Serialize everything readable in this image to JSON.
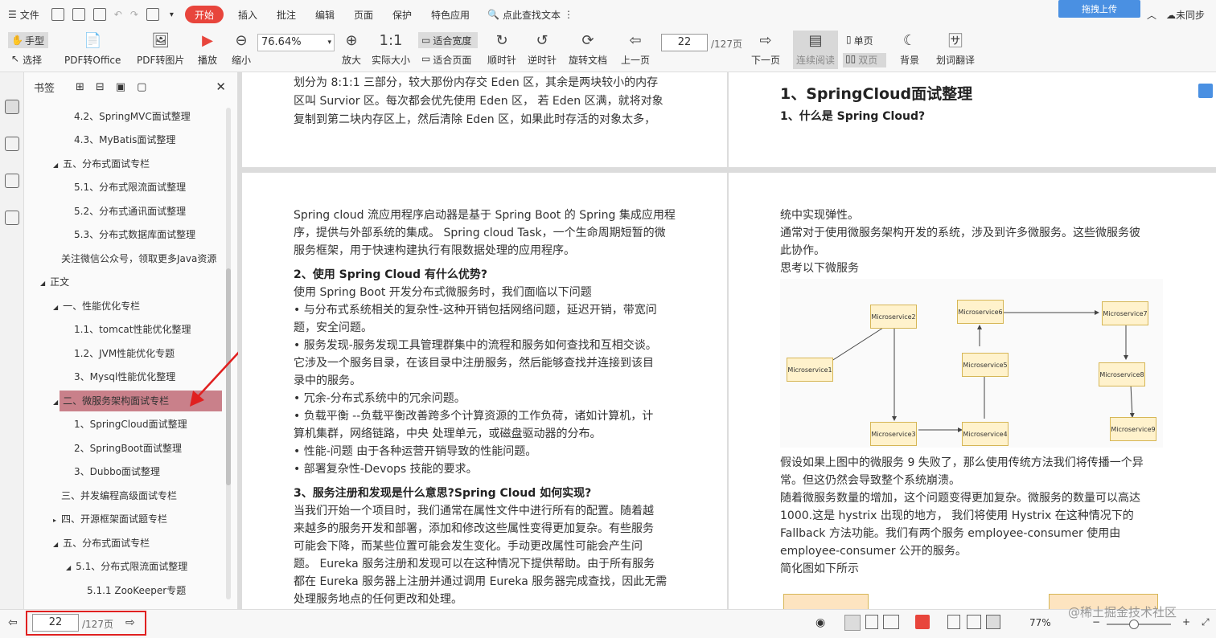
{
  "menubar": {
    "file": "文件",
    "tabs": [
      "开始",
      "插入",
      "批注",
      "编辑",
      "页面",
      "保护",
      "特色应用"
    ],
    "search": "点此查找文本",
    "upload": "拖拽上传",
    "sync": "未同步"
  },
  "toolbar": {
    "hand": "手型",
    "select": "选择",
    "pdf2office": "PDF转Office",
    "pdf2img": "PDF转图片",
    "play": "播放",
    "zoomout": "缩小",
    "zoom": "76.64%",
    "zoomin": "放大",
    "actual": "实际大小",
    "fitwidth": "适合宽度",
    "fitpage": "适合页面",
    "cw": "顺时针",
    "ccw": "逆时针",
    "rotate": "旋转文档",
    "prev": "上一页",
    "page": "22",
    "total": "/127页",
    "next": "下一页",
    "continuous": "连续阅读",
    "single": "单页",
    "double": "双页",
    "bg": "背景",
    "translate": "划词翻译"
  },
  "bookmarks": {
    "title": "书签",
    "items": [
      "4.2、SpringMVC面试整理",
      "4.3、MyBatis面试整理",
      "五、分布式面试专栏",
      "5.1、分布式限流面试整理",
      "5.2、分布式通讯面试整理",
      "5.3、分布式数据库面试整理",
      "关注微信公众号，领取更多Java资源",
      "正文",
      "一、性能优化专栏",
      "1.1、tomcat性能优化整理",
      "1.2、JVM性能优化专题",
      "3、Mysql性能优化整理",
      "二、微服务架构面试专栏",
      "1、SpringCloud面试整理",
      "2、SpringBoot面试整理",
      "3、Dubbo面试整理",
      "三、并发编程高级面试专栏",
      "四、开源框架面试题专栏",
      "五、分布式面试专栏",
      "5.1、分布式限流面试整理",
      "5.1.1 ZooKeeper专题"
    ]
  },
  "page_left_top": {
    "lines": [
      "划分为 8:1:1 三部分，较大那份内存交 Eden 区，其余是两块较小的内存",
      "区叫 Survior 区。每次都会优先使用 Eden 区， 若 Eden 区满，就将对象",
      "复制到第二块内存区上，然后清除 Eden 区，如果此时存活的对象太多，"
    ]
  },
  "page_right_top": {
    "h1": "1、SpringCloud面试整理",
    "h2": "1、什么是 Spring Cloud?"
  },
  "page_left": {
    "p1": [
      "Spring cloud 流应用程序启动器是基于 Spring Boot 的 Spring 集成应用程",
      "序，提供与外部系统的集成。 Spring cloud Task，一个生命周期短暂的微",
      "服务框架，用于快速构建执行有限数据处理的应用程序。"
    ],
    "h2": "2、使用 Spring Cloud 有什么优势?",
    "p2": [
      "使用 Spring Boot 开发分布式微服务时，我们面临以下问题",
      "• 与分布式系统相关的复杂性-这种开销包括网络问题，延迟开销，带宽问",
      "题，安全问题。",
      "• 服务发现-服务发现工具管理群集中的流程和服务如何查找和互相交谈。",
      "它涉及一个服务目录，在该目录中注册服务，然后能够查找并连接到该目",
      "录中的服务。",
      "• 冗余-分布式系统中的冗余问题。",
      "• 负载平衡 --负载平衡改善跨多个计算资源的工作负荷，诸如计算机，计",
      "算机集群，网络链路，中央 处理单元，或磁盘驱动器的分布。",
      "• 性能-问题 由于各种运营开销导致的性能问题。",
      "• 部署复杂性-Devops 技能的要求。"
    ],
    "h3": "3、服务注册和发现是什么意思?Spring Cloud 如何实现?",
    "p3": [
      "当我们开始一个项目时，我们通常在属性文件中进行所有的配置。随着越",
      "来越多的服务开发和部署，添加和修改这些属性变得更加复杂。有些服务",
      "可能会下降，而某些位置可能会发生变化。手动更改属性可能会产生问",
      "题。 Eureka 服务注册和发现可以在这种情况下提供帮助。由于所有服务",
      "都在 Eureka 服务器上注册并通过调用 Eureka 服务器完成查找，因此无需",
      "处理服务地点的任何更改和处理。"
    ]
  },
  "page_right": {
    "p1": [
      "统中实现弹性。",
      "通常对于使用微服务架构开发的系统，涉及到许多微服务。这些微服务彼",
      "此协作。",
      "思考以下微服务"
    ],
    "p2": [
      "假设如果上图中的微服务 9 失败了，那么使用传统方法我们将传播一个异",
      "常。但这仍然会导致整个系统崩溃。",
      "随着微服务数量的增加，这个问题变得更加复杂。微服务的数量可以高达",
      "1000.这是 hystrix 出现的地方， 我们将使用 Hystrix 在这种情况下的",
      "Fallback 方法功能。我们有两个服务 employee-consumer 使用由",
      "employee-consumer 公开的服务。",
      "简化图如下所示"
    ],
    "diagram": [
      "Microservice1",
      "Microservice2",
      "Microservice3",
      "Microservice4",
      "Microservice5",
      "Microservice6",
      "Microservice7",
      "Microservice8",
      "Microservice9"
    ]
  },
  "status": {
    "page": "22",
    "total": "/127页",
    "zoom": "77%",
    "watermark": "@稀土掘金技术社区"
  }
}
